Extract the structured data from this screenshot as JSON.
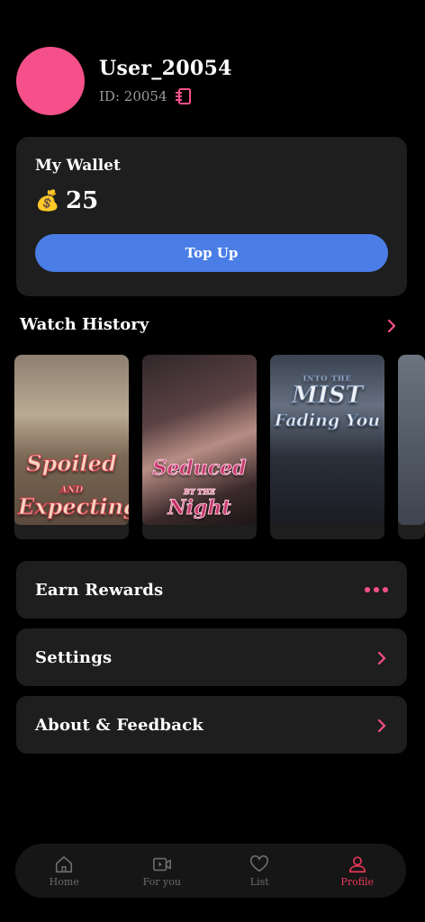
{
  "profile": {
    "username": "User_20054",
    "id_text": "ID: 20054",
    "avatar_color": "#f5508a"
  },
  "wallet": {
    "title": "My Wallet",
    "icon": "money-bag-icon",
    "balance": "25",
    "topup_label": "Top Up",
    "button_color": "#4a7ee6"
  },
  "history": {
    "title": "Watch History",
    "posters": [
      {
        "title_top": "Spoiled",
        "title_mid": "AND",
        "title_bottom": "Expecting"
      },
      {
        "title_top": "Seduced",
        "title_mid": "BY THE",
        "title_bottom": "Night"
      },
      {
        "title_top": "INTO THE",
        "title_mid": "MIST",
        "title_bottom": "Fading You"
      }
    ]
  },
  "menu": {
    "earn_rewards": "Earn Rewards",
    "settings": "Settings",
    "about": "About & Feedback"
  },
  "tabs": [
    {
      "label": "Home",
      "icon": "home-icon"
    },
    {
      "label": "For you",
      "icon": "video-icon"
    },
    {
      "label": "List",
      "icon": "heart-icon"
    },
    {
      "label": "Profile",
      "icon": "profile-icon"
    }
  ],
  "accent_color": "#f5508a",
  "active_tab": "Profile"
}
